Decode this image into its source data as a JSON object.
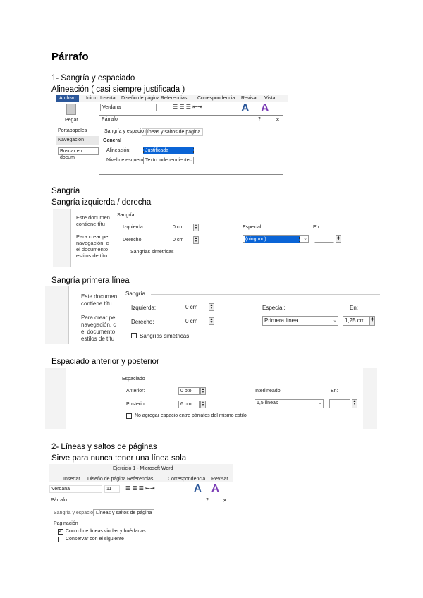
{
  "title": "Párrafo",
  "s1": {
    "heading": "1- Sangría y espaciado",
    "sub": "Alineación ( casi siempre justificada )",
    "tabs": [
      "Archivo",
      "Inicio",
      "Insertar",
      "Diseño de página",
      "Referencias",
      "Correspondencia",
      "Revisar",
      "Vista"
    ],
    "font": "Verdana",
    "paste": "Pegar",
    "clipboard": "Portapapeles",
    "nav": "Navegación",
    "nav_search": "Buscar en docum",
    "dialog_title": "Párrafo",
    "help": "?",
    "close": "✕",
    "dtab1": "Sangría y espacio",
    "dtab2": "Líneas y saltos de página",
    "general": "General",
    "align_label": "Alineación:",
    "align_value": "Justificada",
    "level_label": "Nivel de esquema:",
    "level_value": "Texto independiente"
  },
  "s2": {
    "heading": "Sangría",
    "sub": "Sangría izquierda / derecha",
    "doc": [
      "Este documen",
      "contiene títu",
      "Para crear pe",
      "navegación, c",
      "el documento",
      "estilos de títu"
    ],
    "group": "Sangría",
    "left": "Izquierda:",
    "left_v": "0 cm",
    "right": "Derecho:",
    "right_v": "0 cm",
    "special": "Especial:",
    "special_v": "(ninguno)",
    "by": "En:",
    "mirror": "Sangrías simétricas"
  },
  "s3": {
    "heading": "Sangría primera línea",
    "doc": [
      "Este documen",
      "contiene títu",
      "Para crear pe",
      "navegación, c",
      "el documento",
      "estilos de títu"
    ],
    "group": "Sangría",
    "left": "Izquierda:",
    "left_v": "0 cm",
    "right": "Derecho:",
    "right_v": "0 cm",
    "special": "Especial:",
    "special_v": "Primera línea",
    "by": "En:",
    "by_v": "1,25 cm",
    "mirror": "Sangrías simétricas"
  },
  "s4": {
    "heading": "Espaciado anterior y posterior",
    "group": "Espaciado",
    "before": "Anterior:",
    "before_v": "0 pto",
    "after": "Posterior:",
    "after_v": "6 pto",
    "line": "Interlineado:",
    "line_v": "1,5 líneas",
    "at": "En:",
    "noadd": "No agregar espacio entre párrafos del mismo estilo"
  },
  "s5": {
    "heading": "2- Líneas y saltos de páginas",
    "sub": "Sirve para nunca tener una línea sola",
    "window": "Ejercicio 1 - Microsoft Word",
    "tabs": [
      "Insertar",
      "Diseño de página",
      "Referencias",
      "Correspondencia",
      "Revisar"
    ],
    "font": "Verdana",
    "size": "11",
    "dialog_title": "Párrafo",
    "help": "?",
    "close": "✕",
    "dtab1": "Sangría y espacio",
    "dtab2": "Líneas y saltos de página",
    "pagination": "Paginación",
    "widow": "Control de líneas viudas y huérfanas",
    "keep": "Conservar con el siguiente",
    "check": "✓"
  }
}
